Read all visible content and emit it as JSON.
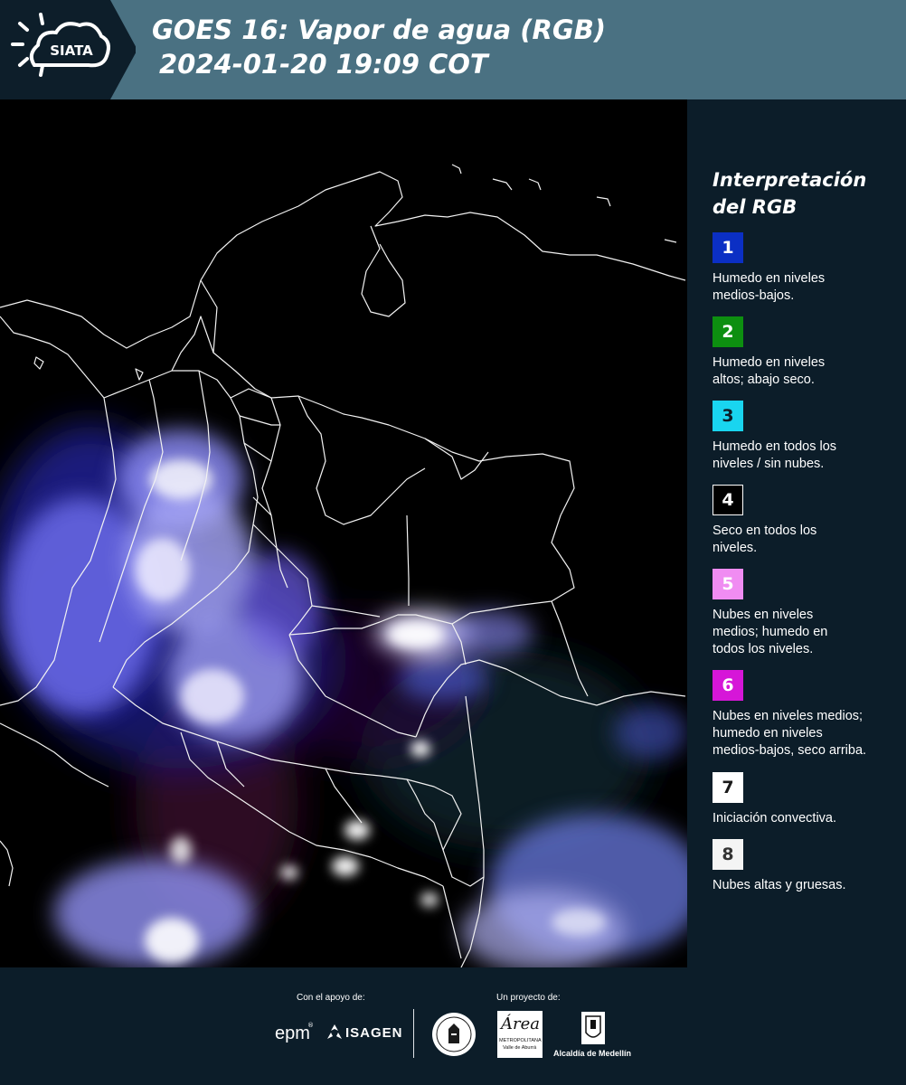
{
  "header": {
    "logo_text": "SIATA",
    "title_line1": "GOES 16: Vapor de agua (RGB)",
    "title_line2": "2024-01-20 19:09 COT"
  },
  "legend": {
    "title_line1": "Interpretación",
    "title_line2": "del RGB",
    "items": [
      {
        "number": "1",
        "color": "#0b2fc4",
        "text_color": "#ffffff",
        "line1": "Humedo en niveles",
        "line2": "medios-bajos.",
        "line3": ""
      },
      {
        "number": "2",
        "color": "#0d8f10",
        "text_color": "#ffffff",
        "line1": "Humedo en niveles",
        "line2": "altos; abajo seco.",
        "line3": ""
      },
      {
        "number": "3",
        "color": "#19d5f0",
        "text_color": "#0c1d29",
        "line1": "Humedo en todos los",
        "line2": "niveles / sin nubes.",
        "line3": ""
      },
      {
        "number": "4",
        "color": "#000000",
        "text_color": "#ffffff",
        "line1": "Seco en todos los",
        "line2": "niveles.",
        "line3": ""
      },
      {
        "number": "5",
        "color": "#f08cf2",
        "text_color": "#ffffff",
        "line1": "Nubes en niveles",
        "line2": "medios; humedo en",
        "line3": "todos los niveles."
      },
      {
        "number": "6",
        "color": "#d616d8",
        "text_color": "#ffffff",
        "line1": "Nubes en niveles medios;",
        "line2": "humedo en niveles",
        "line3": "medios-bajos, seco arriba."
      },
      {
        "number": "7",
        "color": "#ffffff",
        "text_color": "#1a1a1a",
        "line1": "Iniciación convectiva.",
        "line2": "",
        "line3": ""
      },
      {
        "number": "8",
        "color": "#f4f4f4",
        "text_color": "#333333",
        "line1": "Nubes altas y gruesas.",
        "line2": "",
        "line3": ""
      }
    ]
  },
  "footer": {
    "support_label": "Con el apoyo de:",
    "project_label": "Un proyecto de:",
    "epm": "epm",
    "isagen": "ISAGEN",
    "area_name": "Área",
    "area_sub1": "METROPOLITANA",
    "area_sub2": "Valle de Aburrá",
    "alcaldia": "Alcaldía de Medellín"
  }
}
